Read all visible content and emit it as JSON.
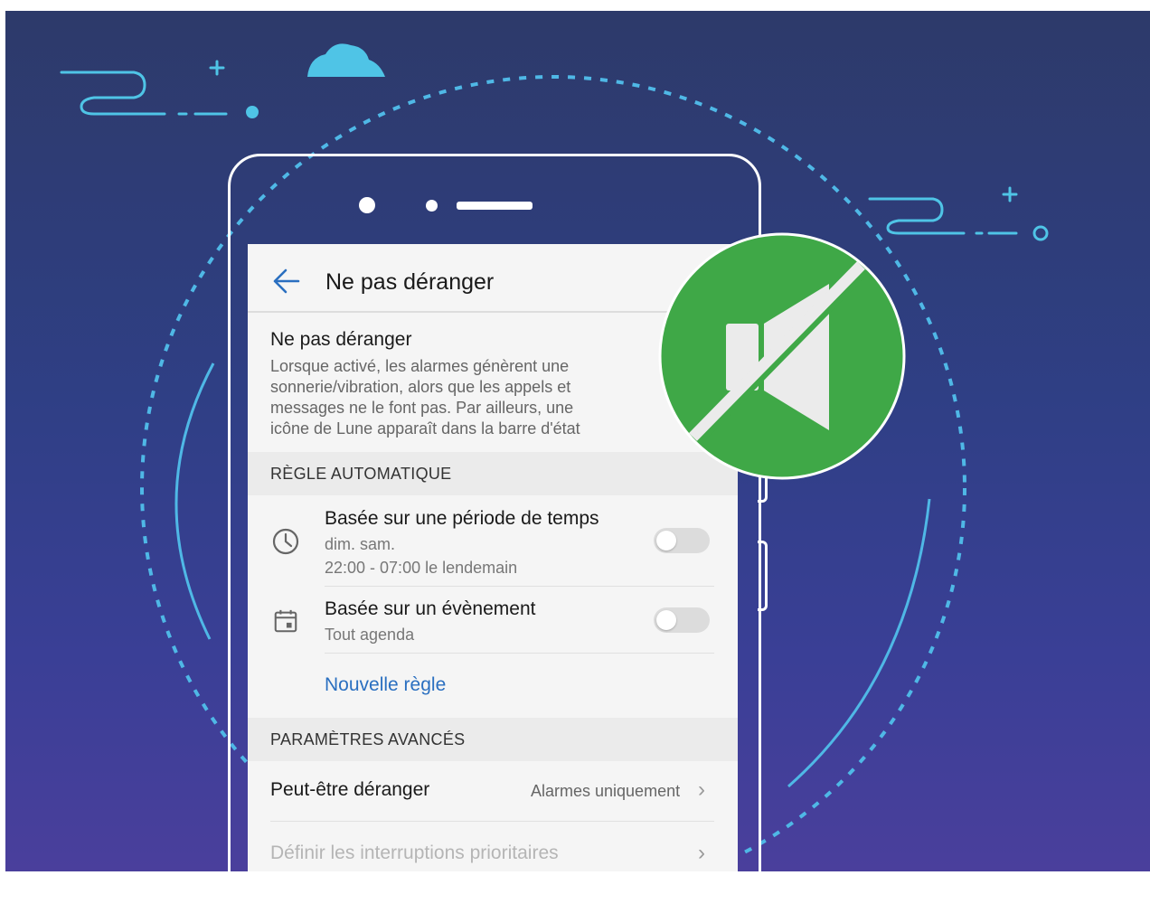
{
  "header": {
    "title": "Ne pas déranger"
  },
  "main_setting": {
    "title": "Ne pas déranger",
    "description_lines": [
      "Lorsque activé, les alarmes génèrent une",
      "sonnerie/vibration, alors que les appels et",
      "messages ne le font pas. Par ailleurs, une",
      "icône de Lune apparaît dans la barre d'état"
    ]
  },
  "auto_rules": {
    "header": "RÈGLE AUTOMATIQUE",
    "items": [
      {
        "title": "Basée sur une période de temps",
        "sub1": "dim. sam.",
        "sub2": "22:00 - 07:00 le lendemain",
        "icon": "clock-icon",
        "enabled": false
      },
      {
        "title": "Basée sur un évènement",
        "sub1": "Tout agenda",
        "icon": "calendar-icon",
        "enabled": false
      }
    ],
    "new_rule": "Nouvelle règle"
  },
  "advanced": {
    "header": "PARAMÈTRES AVANCÉS",
    "items": [
      {
        "title": "Peut-être déranger",
        "value": "Alarmes uniquement"
      },
      {
        "title": "Définir les interruptions prioritaires",
        "value": ""
      }
    ]
  },
  "overlay": {
    "icon": "mute-speaker-icon",
    "color": "#3fa847"
  },
  "colors": {
    "background": "#2f3f85",
    "accent": "#2a6fc0",
    "decoration": "#4fb8e6"
  }
}
